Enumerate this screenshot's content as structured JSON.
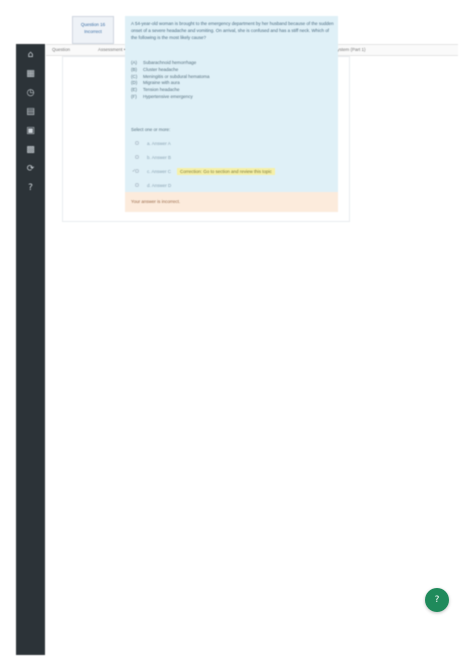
{
  "sidebar": {
    "items": [
      {
        "icon": "home-icon",
        "glyph": "⌂"
      },
      {
        "icon": "dashboard-icon",
        "glyph": "▦"
      },
      {
        "icon": "calendar-icon",
        "glyph": "◷"
      },
      {
        "icon": "inbox-icon",
        "glyph": "▤"
      },
      {
        "icon": "chat-icon",
        "glyph": "▣"
      },
      {
        "icon": "grid-icon",
        "glyph": "▩"
      },
      {
        "icon": "history-icon",
        "glyph": "⟳"
      },
      {
        "icon": "help-icon",
        "glyph": "?"
      }
    ]
  },
  "tag": {
    "line1": "Question 16",
    "line2": "Incorrect"
  },
  "urlbar": {
    "left": "Question",
    "middle": "Assessment • Neurology: Clinical Examination of the Nervous System",
    "right": "Clinical Examination of the Nervous System (Part 1)"
  },
  "question": {
    "text": "A 54-year-old woman is brought to the emergency department by her husband because of the sudden onset of a severe headache and vomiting. On arrival, she is confused and has a stiff neck. Which of the following is the most likely cause?",
    "options": [
      {
        "letter": "(A)",
        "text": "Subarachnoid hemorrhage"
      },
      {
        "letter": "(B)",
        "text": "Cluster headache"
      },
      {
        "letter": "(C)",
        "text": "Meningitis or subdural hematoma"
      },
      {
        "letter": "(D)",
        "text": "Migraine with aura"
      },
      {
        "letter": "(E)",
        "text": "Tension headache"
      },
      {
        "letter": "(F)",
        "text": "Hypertensive emergency"
      }
    ],
    "select_label": "Select one or more:",
    "answers": [
      {
        "mark": "",
        "text": "a. Answer A"
      },
      {
        "mark": "",
        "text": "b. Answer B"
      },
      {
        "mark": "✓",
        "text": "c. Answer C",
        "note": "Correction: Go to section and review this topic"
      },
      {
        "mark": "",
        "text": "d. Answer D"
      }
    ],
    "feedback": "Your answer is incorrect."
  },
  "fab": {
    "glyph": "?",
    "icon": "help-icon"
  }
}
